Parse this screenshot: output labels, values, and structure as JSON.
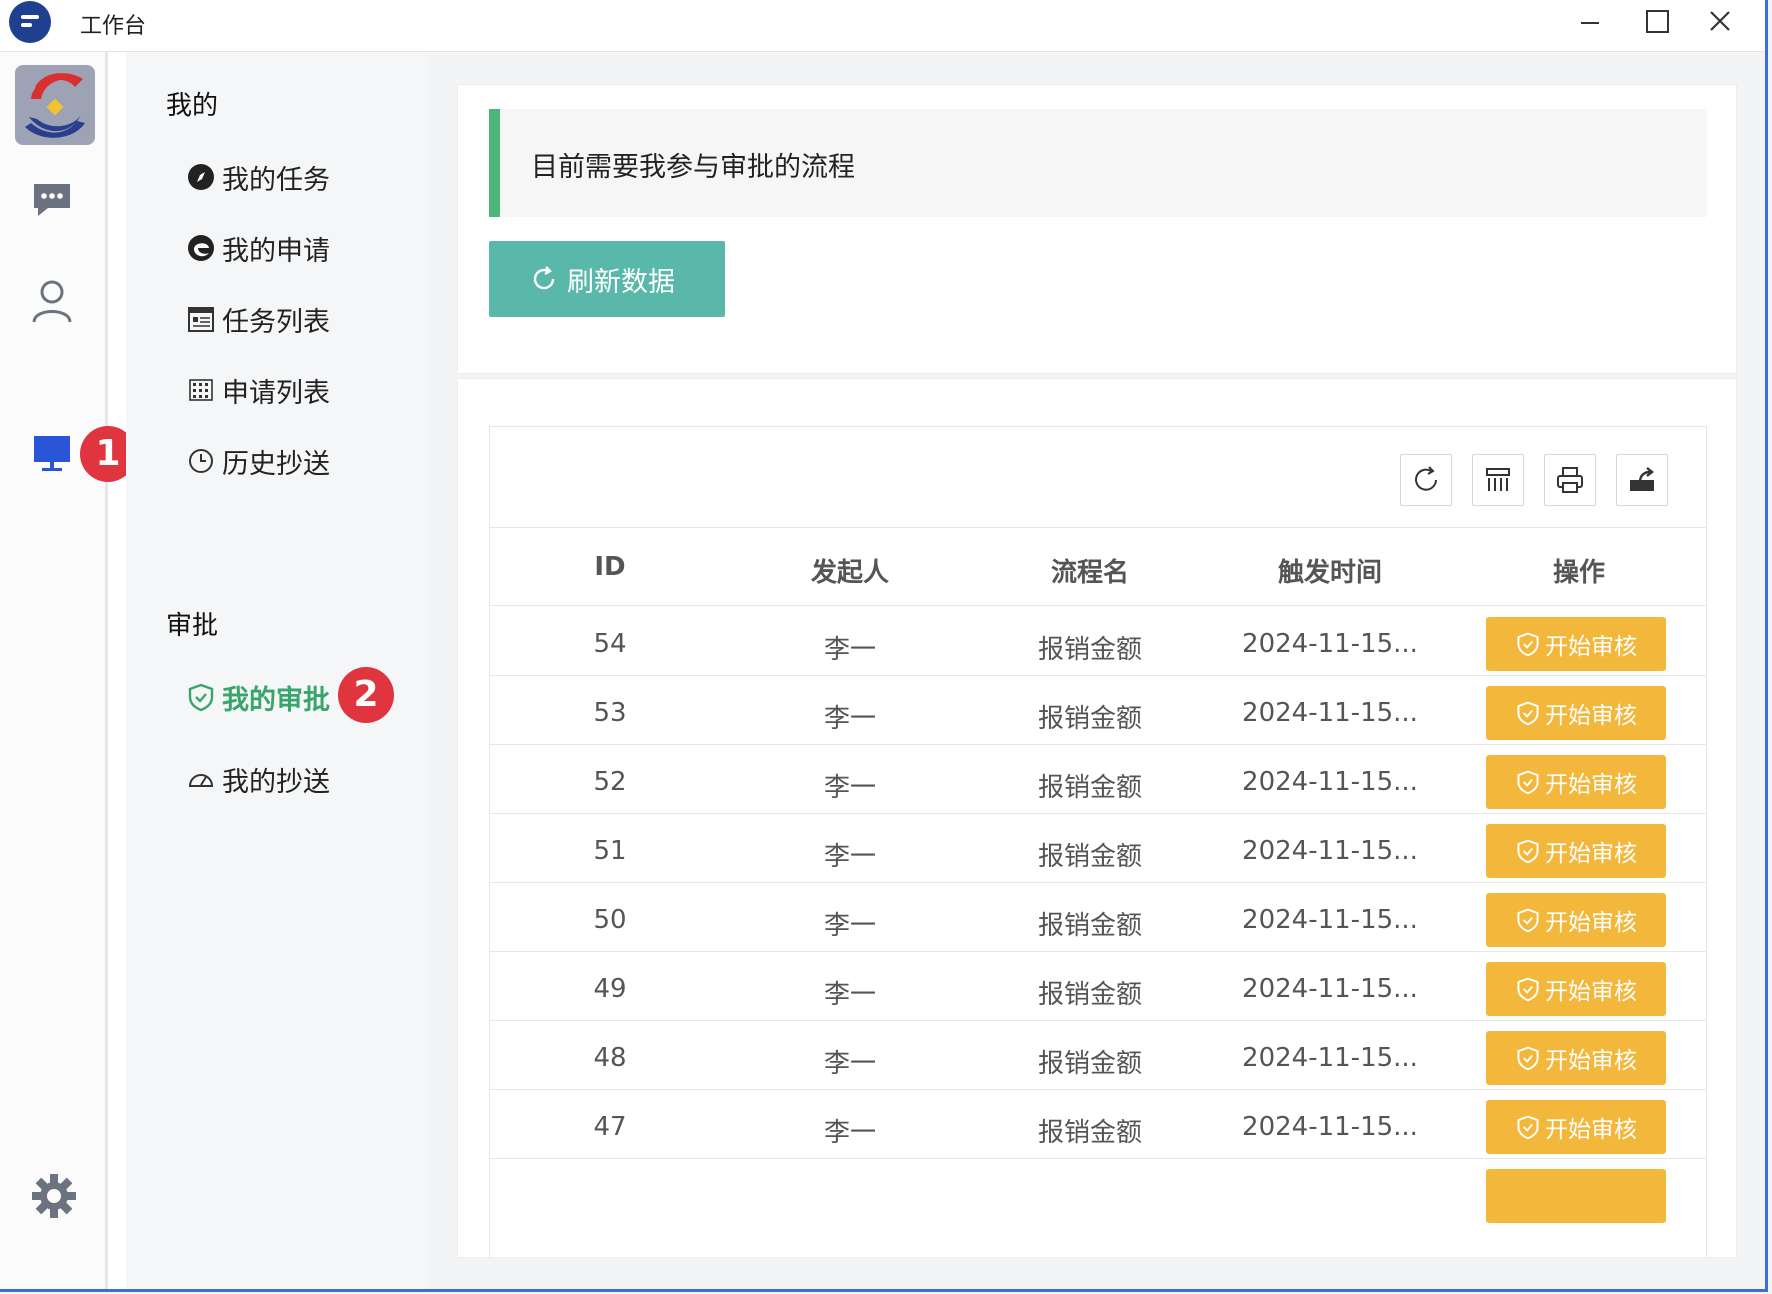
{
  "window": {
    "title": "工作台"
  },
  "rail": {
    "items": [
      "messages-icon",
      "contacts-icon",
      "workbench-icon",
      "settings-icon"
    ],
    "badge_1": "1"
  },
  "menu": {
    "group_mine": "我的",
    "items_mine": [
      "我的任务",
      "我的申请",
      "任务列表",
      "申请列表",
      "历史抄送"
    ],
    "group_approval": "审批",
    "items_approval": [
      "我的审批",
      "我的抄送"
    ],
    "active_item": "我的审批",
    "badge_2": "2"
  },
  "main": {
    "notice": "目前需要我参与审批的流程",
    "refresh_label": "刷新数据",
    "toolbar": [
      "refresh-icon",
      "columns-icon",
      "print-icon",
      "export-icon"
    ],
    "columns": [
      "ID",
      "发起人",
      "流程名",
      "触发时间",
      "操作"
    ],
    "rows": [
      {
        "id": "54",
        "user": "李一",
        "flow": "报销金额",
        "time": "2024-11-15...",
        "action": "开始审核"
      },
      {
        "id": "53",
        "user": "李一",
        "flow": "报销金额",
        "time": "2024-11-15...",
        "action": "开始审核"
      },
      {
        "id": "52",
        "user": "李一",
        "flow": "报销金额",
        "time": "2024-11-15...",
        "action": "开始审核"
      },
      {
        "id": "51",
        "user": "李一",
        "flow": "报销金额",
        "time": "2024-11-15...",
        "action": "开始审核"
      },
      {
        "id": "50",
        "user": "李一",
        "flow": "报销金额",
        "time": "2024-11-15...",
        "action": "开始审核"
      },
      {
        "id": "49",
        "user": "李一",
        "flow": "报销金额",
        "time": "2024-11-15...",
        "action": "开始审核"
      },
      {
        "id": "48",
        "user": "李一",
        "flow": "报销金额",
        "time": "2024-11-15...",
        "action": "开始审核"
      },
      {
        "id": "47",
        "user": "李一",
        "flow": "报销金额",
        "time": "2024-11-15...",
        "action": "开始审核"
      }
    ]
  },
  "colors": {
    "accent_green": "#4db57b",
    "refresh_btn": "#59b8a9",
    "audit_btn": "#f3b83b",
    "badge_red": "#e0353f",
    "rail_active": "#2a55d6"
  }
}
